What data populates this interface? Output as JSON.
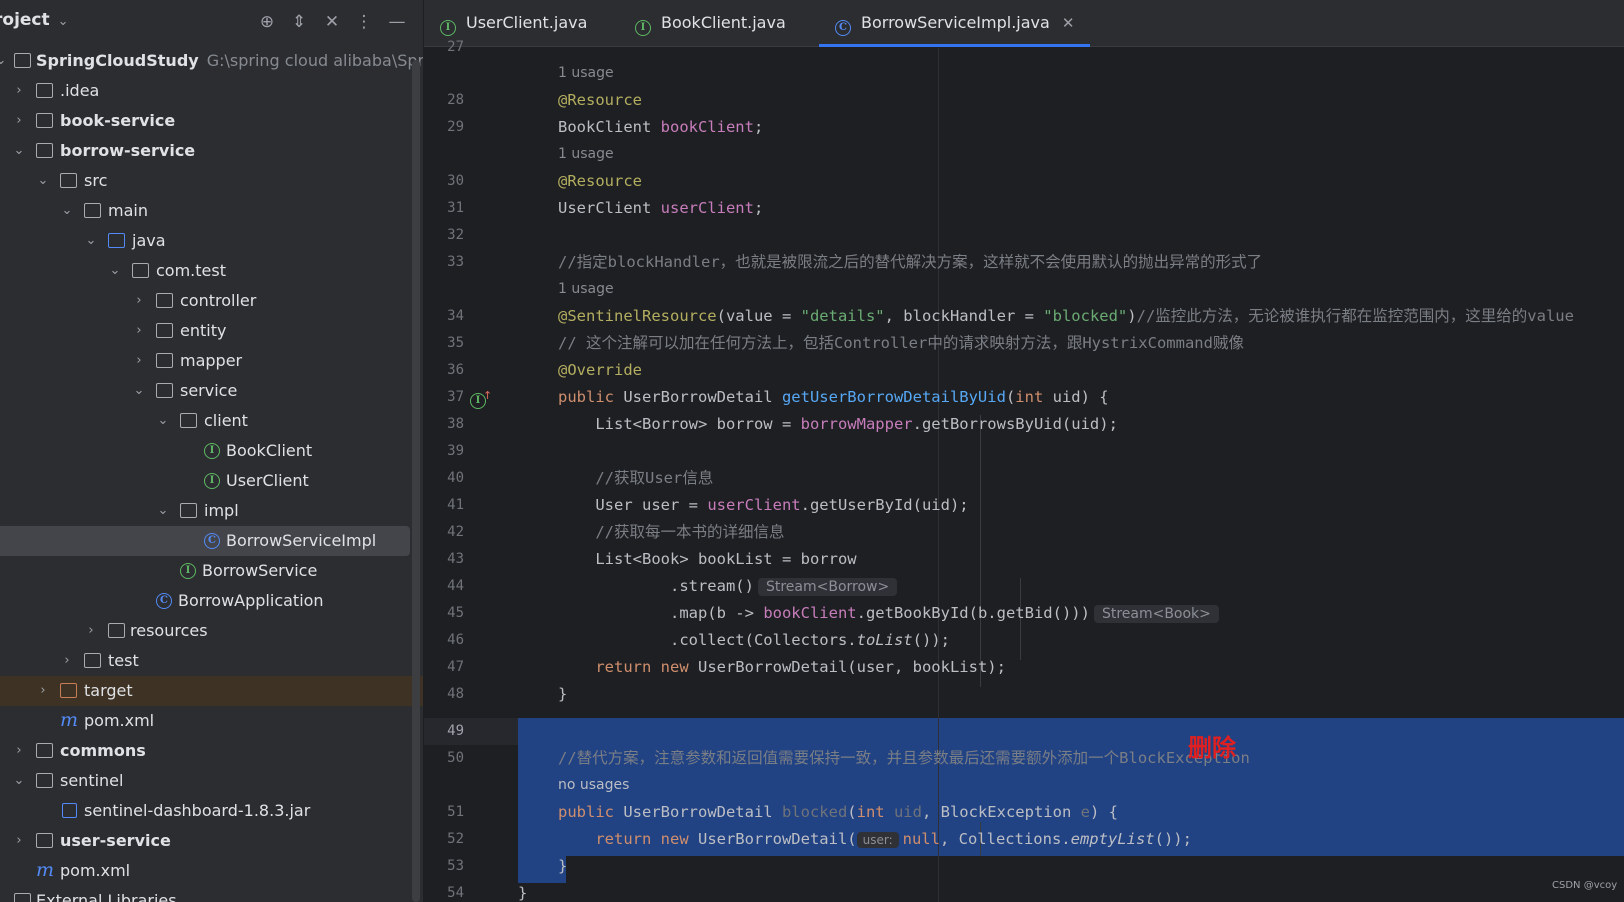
{
  "project_panel": {
    "title": "roject",
    "header_icons": [
      "crosshair-icon",
      "expand-icon",
      "collapse-icon",
      "more-icon",
      "minimize-icon"
    ],
    "tree": [
      {
        "label": "SpringCloudStudy",
        "extra": "G:\\spring cloud alibaba\\Sprin",
        "bold": true
      },
      {
        "label": ".idea"
      },
      {
        "label": "book-service",
        "bold": true
      },
      {
        "label": "borrow-service",
        "bold": true
      },
      {
        "label": "src"
      },
      {
        "label": "main"
      },
      {
        "label": "java"
      },
      {
        "label": "com.test"
      },
      {
        "label": "controller"
      },
      {
        "label": "entity"
      },
      {
        "label": "mapper"
      },
      {
        "label": "service"
      },
      {
        "label": "client"
      },
      {
        "label": "BookClient"
      },
      {
        "label": "UserClient"
      },
      {
        "label": "impl"
      },
      {
        "label": "BorrowServiceImpl"
      },
      {
        "label": "BorrowService"
      },
      {
        "label": "BorrowApplication"
      },
      {
        "label": "resources"
      },
      {
        "label": "test"
      },
      {
        "label": "target"
      },
      {
        "label": "pom.xml"
      },
      {
        "label": "commons",
        "bold": true
      },
      {
        "label": "sentinel"
      },
      {
        "label": "sentinel-dashboard-1.8.3.jar"
      },
      {
        "label": "user-service",
        "bold": true
      },
      {
        "label": "pom.xml"
      },
      {
        "label": "External Libraries"
      }
    ]
  },
  "tabs": [
    {
      "label": "UserClient.java"
    },
    {
      "label": "BookClient.java"
    },
    {
      "label": "BorrowServiceImpl.java",
      "active": true
    }
  ],
  "editor": {
    "usage_hints": [
      "1 usage",
      "1 usage",
      "1 usage",
      "no usages"
    ],
    "line_numbers": [
      "27",
      "28",
      "29",
      "30",
      "31",
      "32",
      "33",
      "34",
      "35",
      "36",
      "37",
      "38",
      "39",
      "40",
      "41",
      "42",
      "43",
      "44",
      "45",
      "46",
      "47",
      "48",
      "49",
      "50",
      "51",
      "52",
      "53",
      "54"
    ],
    "code": {
      "l28": "@Resource",
      "l29_type": "BookClient ",
      "l29_field": "bookClient",
      "l29_end": ";",
      "l30": "@Resource",
      "l31_type": "UserClient ",
      "l31_field": "userClient",
      "l31_end": ";",
      "l33": "//指定blockHandler，也就是被限流之后的替代解决方案，这样就不会使用默认的抛出异常的形式了",
      "l34_ann": "@SentinelResource",
      "l34_a": "(value = ",
      "l34_s1": "\"details\"",
      "l34_b": ", blockHandler = ",
      "l34_s2": "\"blocked\"",
      "l34_c": ")",
      "l34_cmt": "//监控此方法，无论被谁执行都在监控范围内，这里给的value",
      "l35": "// 这个注解可以加在任何方法上，包括Controller中的请求映射方法，跟HystrixCommand贼像",
      "l36": "@Override",
      "l37_kw": "public ",
      "l37_type": "UserBorrowDetail ",
      "l37_fn": "getUserBorrowDetailByUid",
      "l37_a": "(",
      "l37_int": "int",
      "l37_b": " uid) {",
      "l38_a": "    List<Borrow> borrow = ",
      "l38_fld": "borrowMapper",
      "l38_b": ".getBorrowsByUid(uid);",
      "l40": "    //获取User信息",
      "l41_a": "    User user = ",
      "l41_fld": "userClient",
      "l41_b": ".getUserById(uid);",
      "l42": "    //获取每一本书的详细信息",
      "l43": "    List<Book> bookList = borrow",
      "l44": "            .stream()",
      "l44_hint": "Stream<Borrow>",
      "l45_a": "            .map(b -> ",
      "l45_fld": "bookClient",
      "l45_b": ".getBookById(b.getBid()))",
      "l45_hint": "Stream<Book>",
      "l46_a": "            .collect(Collectors.",
      "l46_it": "toList",
      "l46_b": "());",
      "l47_kw1": "    return ",
      "l47_kw2": "new ",
      "l47_b": "UserBorrowDetail(user, bookList);",
      "l48": "}",
      "l50": "//替代方案，注意参数和返回值需要保持一致，并且参数最后还需要额外添加一个BlockException",
      "l51_kw": "public ",
      "l51_type": "UserBorrowDetail ",
      "l51_fn": "blocked",
      "l51_a": "(",
      "l51_int": "int",
      "l51_p1": " uid",
      "l51_b": ", BlockException ",
      "l51_p2": "e",
      "l51_c": ") {",
      "l52_kw1": "    return ",
      "l52_kw2": "new ",
      "l52_a": "UserBorrowDetail(",
      "l52_hint": "user:",
      "l52_null": "null",
      "l52_b": ", Collections.",
      "l52_it": "emptyList",
      "l52_c": "());",
      "l53": "}",
      "l54": "}"
    }
  },
  "overlay_label": "删除",
  "watermark": "CSDN @vcoy",
  "colors": {
    "keyword": "#cf8e6d",
    "annotation": "#b3ae60",
    "field": "#c77dbb",
    "string": "#6aab73",
    "comment": "#7a7e85",
    "function": "#56a8f5",
    "selection": "#214283",
    "overlay_label": "#e02020"
  }
}
